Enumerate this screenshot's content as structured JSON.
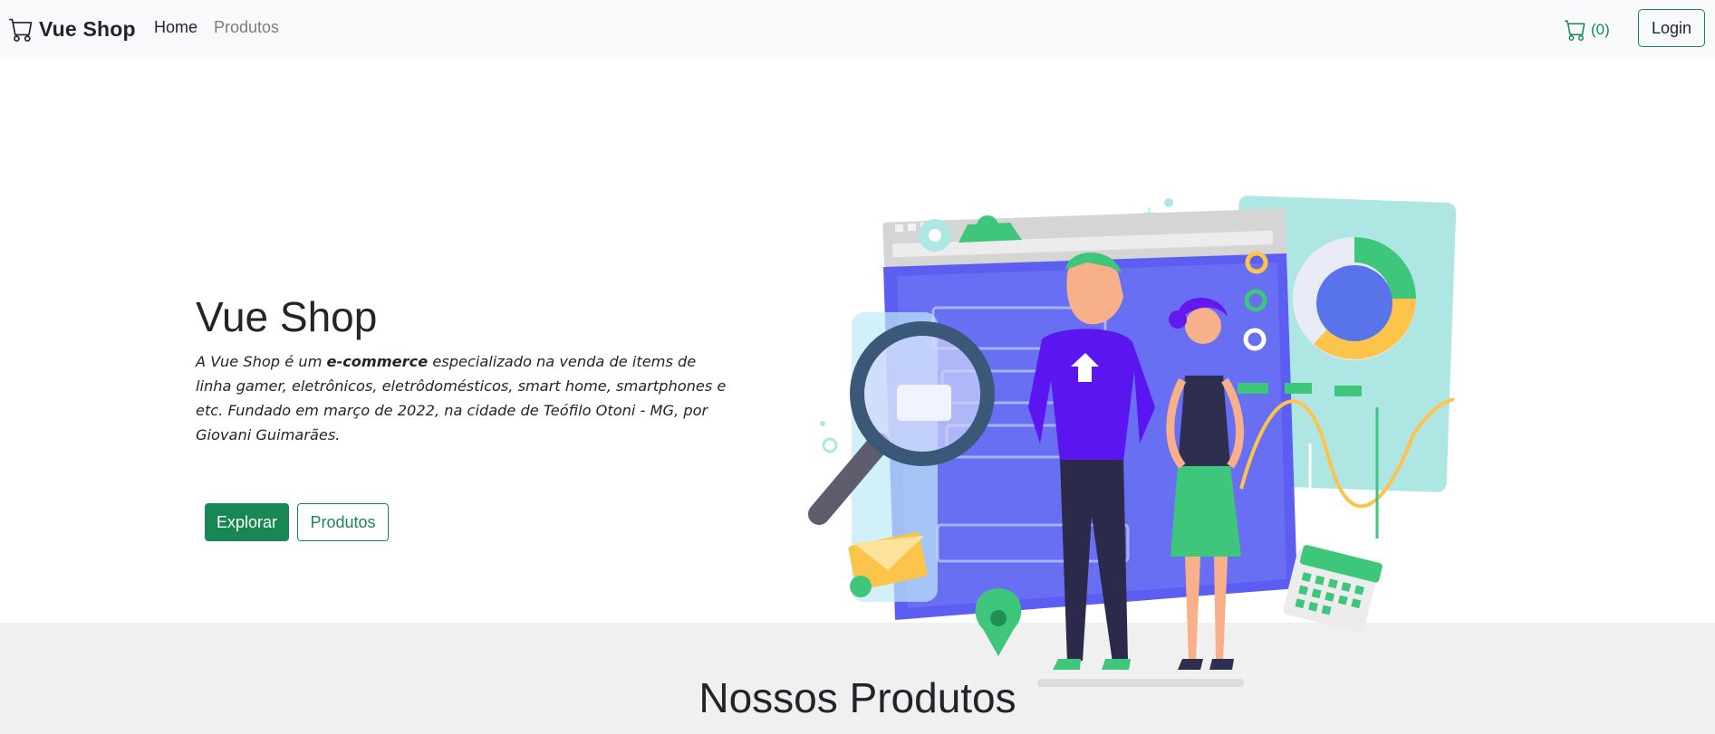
{
  "navbar": {
    "brand": "Vue Shop",
    "links": [
      {
        "label": "Home",
        "active": true
      },
      {
        "label": "Produtos",
        "active": false
      }
    ],
    "cart_count": "(0)",
    "login_label": "Login"
  },
  "hero": {
    "title": "Vue Shop",
    "desc_part1": "A Vue Shop é um ",
    "desc_bold": "e-commerce",
    "desc_part2": " especializado na venda de items de linha gamer, eletrônicos, eletrôdomésticos, smart home, smartphones e etc. Fundado em março de 2022, na cidade de Teófilo Otoni - MG, por Giovani Guimarães.",
    "buttons": {
      "primary": "Explorar",
      "secondary": "Produtos"
    }
  },
  "products_section": {
    "title": "Nossos Produtos"
  },
  "colors": {
    "accent": "#198754",
    "navbar_bg": "#f8f9fa",
    "section_bg": "#f0f0f0"
  },
  "icons": [
    "cart-icon",
    "cart-icon"
  ]
}
